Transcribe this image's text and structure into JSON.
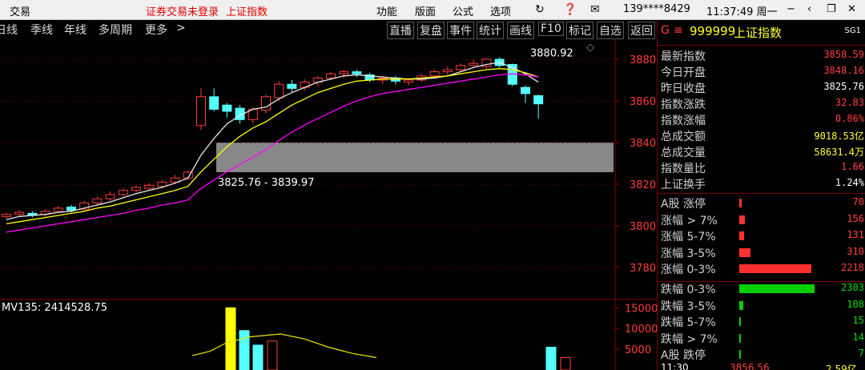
{
  "titlebar": {
    "menu_trade": "交易",
    "status_notice": "证券交易未登录",
    "index_name": "上证指数",
    "menu_function": "功能",
    "menu_layout": "版面",
    "menu_formula": "公式",
    "menu_options": "选项",
    "user": "139****8429",
    "clock": "11:37:49 周一"
  },
  "toolbar": {
    "period_items": [
      "日线",
      "季线",
      "年线",
      "多周期",
      "更多"
    ],
    "more_arrow": ">",
    "action_items": [
      "直播",
      "复盘",
      "事件",
      "统计",
      "画线",
      "F10",
      "标记",
      "自选",
      "返回"
    ]
  },
  "panel": {
    "header": {
      "prefix": "G",
      "code": "999999",
      "name": "上证指数",
      "tag": "SG1"
    },
    "stats": [
      {
        "label": "最新指数",
        "value": "3858.59",
        "color": "#ff4040"
      },
      {
        "label": "今日开盘",
        "value": "3848.16",
        "color": "#ff4040"
      },
      {
        "label": "昨日收盘",
        "value": "3825.76",
        "color": "#ffffff"
      },
      {
        "label": "指数涨跌",
        "value": "32.83",
        "color": "#ff4040"
      },
      {
        "label": "指数涨幅",
        "value": "0.86%",
        "color": "#ff4040"
      },
      {
        "label": "总成交额",
        "value": "9018.53亿",
        "color": "#ffff33"
      },
      {
        "label": "总成交量",
        "value": "58631.4万",
        "color": "#ffff33"
      },
      {
        "label": "指数量比",
        "value": "1.66",
        "color": "#ff4040"
      },
      {
        "label": "上证换手",
        "value": "1.24%",
        "color": "#ffffff"
      }
    ],
    "breadth": [
      {
        "label": "A股 涨停",
        "value": "70",
        "frac": 0.013,
        "color": "#ff3030"
      },
      {
        "label": "涨幅 > 7%",
        "value": "156",
        "frac": 0.03,
        "color": "#ff3030"
      },
      {
        "label": "涨幅 5-7%",
        "value": "131",
        "frac": 0.025,
        "color": "#ff3030"
      },
      {
        "label": "涨幅 3-5%",
        "value": "310",
        "frac": 0.06,
        "color": "#ff3030"
      },
      {
        "label": "涨幅 0-3%",
        "value": "2218",
        "frac": 0.39,
        "color": "#ff3030"
      },
      {
        "label": "跌幅 0-3%",
        "value": "2303",
        "frac": 0.41,
        "color": "#00d000"
      },
      {
        "label": "跌幅 3-5%",
        "value": "108",
        "frac": 0.02,
        "color": "#00d000"
      },
      {
        "label": "跌幅 5-7%",
        "value": "15",
        "frac": 0.006,
        "color": "#00d000"
      },
      {
        "label": "跌幅 > 7%",
        "value": "14",
        "frac": 0.006,
        "color": "#00d000"
      },
      {
        "label": "A股 跌停",
        "value": "7",
        "frac": 0.004,
        "color": "#00d000"
      }
    ],
    "footer_time": "11:30",
    "footer_value": "3856.56",
    "footer_extra": "2.59亿"
  },
  "chart_data": {
    "type": "candlestick",
    "y_ticks": [
      "3880",
      "3860",
      "3840",
      "3820",
      "3800",
      "3780"
    ],
    "ylim": [
      3770,
      3890
    ],
    "high_label": "3880.92",
    "gap_label": "3825.76 - 3839.97",
    "gap_range": [
      3825.76,
      3839.97
    ],
    "volume_label": "MV135: 2414528.75",
    "volume_ticks": [
      "15000",
      "10000",
      "5000"
    ],
    "volume_ylim": [
      0,
      17000
    ],
    "candles": [
      {
        "o": 3804.5,
        "c": 3805.5,
        "h": 3806.5,
        "l": 3803.5
      },
      {
        "o": 3805.5,
        "c": 3806.5,
        "h": 3807.5,
        "l": 3804.5
      },
      {
        "o": 3806.0,
        "c": 3805.0,
        "h": 3807.0,
        "l": 3804.0
      },
      {
        "o": 3805.5,
        "c": 3807.0,
        "h": 3808.0,
        "l": 3804.5
      },
      {
        "o": 3807.0,
        "c": 3808.5,
        "h": 3809.5,
        "l": 3806.0
      },
      {
        "o": 3809.0,
        "c": 3807.5,
        "h": 3810.0,
        "l": 3806.5
      },
      {
        "o": 3808.0,
        "c": 3811.0,
        "h": 3812.0,
        "l": 3807.0
      },
      {
        "o": 3811.0,
        "c": 3813.0,
        "h": 3814.0,
        "l": 3810.0
      },
      {
        "o": 3813.0,
        "c": 3815.0,
        "h": 3816.5,
        "l": 3812.0
      },
      {
        "o": 3815.0,
        "c": 3817.0,
        "h": 3818.0,
        "l": 3814.0
      },
      {
        "o": 3817.0,
        "c": 3818.5,
        "h": 3819.5,
        "l": 3816.0
      },
      {
        "o": 3818.0,
        "c": 3819.5,
        "h": 3820.5,
        "l": 3817.0
      },
      {
        "o": 3819.0,
        "c": 3821.0,
        "h": 3822.0,
        "l": 3818.0
      },
      {
        "o": 3821.0,
        "c": 3823.0,
        "h": 3824.5,
        "l": 3820.0
      },
      {
        "o": 3823.0,
        "c": 3825.76,
        "h": 3826.5,
        "l": 3822.0
      },
      {
        "o": 3848.16,
        "c": 3862.0,
        "h": 3866.0,
        "l": 3846.0
      },
      {
        "o": 3862.0,
        "c": 3856.0,
        "h": 3866.0,
        "l": 3855.0
      },
      {
        "o": 3858.0,
        "c": 3855.0,
        "h": 3859.0,
        "l": 3852.0
      },
      {
        "o": 3856.5,
        "c": 3851.0,
        "h": 3858.0,
        "l": 3849.0
      },
      {
        "o": 3851.0,
        "c": 3856.0,
        "h": 3857.0,
        "l": 3849.0
      },
      {
        "o": 3855.5,
        "c": 3862.0,
        "h": 3863.0,
        "l": 3854.0
      },
      {
        "o": 3861.5,
        "c": 3868.0,
        "h": 3869.5,
        "l": 3860.0
      },
      {
        "o": 3868.0,
        "c": 3866.0,
        "h": 3870.0,
        "l": 3864.0
      },
      {
        "o": 3866.5,
        "c": 3869.0,
        "h": 3870.5,
        "l": 3865.0
      },
      {
        "o": 3869.0,
        "c": 3871.0,
        "h": 3872.0,
        "l": 3867.0
      },
      {
        "o": 3871.0,
        "c": 3873.0,
        "h": 3874.0,
        "l": 3870.0
      },
      {
        "o": 3873.0,
        "c": 3874.0,
        "h": 3875.0,
        "l": 3871.0
      },
      {
        "o": 3874.0,
        "c": 3873.0,
        "h": 3875.0,
        "l": 3871.5
      },
      {
        "o": 3872.5,
        "c": 3870.0,
        "h": 3873.5,
        "l": 3869.0
      },
      {
        "o": 3870.0,
        "c": 3871.0,
        "h": 3872.0,
        "l": 3868.0
      },
      {
        "o": 3871.0,
        "c": 3869.5,
        "h": 3872.0,
        "l": 3868.0
      },
      {
        "o": 3869.0,
        "c": 3870.0,
        "h": 3871.0,
        "l": 3867.5
      },
      {
        "o": 3870.0,
        "c": 3872.0,
        "h": 3873.0,
        "l": 3869.0
      },
      {
        "o": 3872.0,
        "c": 3874.0,
        "h": 3875.0,
        "l": 3871.0
      },
      {
        "o": 3874.0,
        "c": 3875.0,
        "h": 3876.5,
        "l": 3872.5
      },
      {
        "o": 3875.0,
        "c": 3877.0,
        "h": 3878.0,
        "l": 3874.0
      },
      {
        "o": 3877.0,
        "c": 3878.0,
        "h": 3880.0,
        "l": 3876.0
      },
      {
        "o": 3876.5,
        "c": 3880.0,
        "h": 3880.5,
        "l": 3875.5
      },
      {
        "o": 3880.0,
        "c": 3877.0,
        "h": 3880.92,
        "l": 3876.0
      },
      {
        "o": 3877.5,
        "c": 3868.0,
        "h": 3878.0,
        "l": 3867.0
      },
      {
        "o": 3866.5,
        "c": 3863.5,
        "h": 3867.5,
        "l": 3859.0
      },
      {
        "o": 3862.5,
        "c": 3858.59,
        "h": 3863.0,
        "l": 3851.5
      }
    ],
    "series": [
      {
        "name": "MA5",
        "color": "#e8e8e8",
        "values": [
          3803.0,
          3804.5,
          3805.0,
          3805.5,
          3806.5,
          3807.0,
          3808.5,
          3810.0,
          3811.5,
          3813.5,
          3815.5,
          3817.0,
          3818.5,
          3820.5,
          3823.0,
          3834.0,
          3842.0,
          3849.0,
          3853.0,
          3856.0,
          3857.0,
          3861.0,
          3864.0,
          3866.5,
          3869.0,
          3870.5,
          3872.0,
          3872.5,
          3872.0,
          3871.5,
          3871.0,
          3870.5,
          3870.5,
          3871.0,
          3872.0,
          3874.0,
          3876.0,
          3877.5,
          3878.5,
          3876.0,
          3873.0,
          3869.0
        ]
      },
      {
        "name": "MA10",
        "color": "#ffff00",
        "values": [
          3801.0,
          3802.0,
          3803.0,
          3804.0,
          3805.0,
          3806.0,
          3807.0,
          3808.5,
          3809.5,
          3811.0,
          3812.5,
          3814.0,
          3815.5,
          3817.0,
          3819.0,
          3826.0,
          3832.0,
          3838.0,
          3843.0,
          3847.0,
          3850.0,
          3854.0,
          3858.0,
          3861.0,
          3864.0,
          3866.0,
          3868.0,
          3869.5,
          3870.0,
          3870.5,
          3870.5,
          3870.5,
          3871.0,
          3871.5,
          3872.0,
          3873.0,
          3874.0,
          3875.0,
          3875.5,
          3875.0,
          3873.5,
          3871.5
        ]
      },
      {
        "name": "MA20",
        "color": "#ff00ff",
        "values": [
          3797.0,
          3798.0,
          3799.0,
          3800.0,
          3801.0,
          3802.0,
          3803.0,
          3804.0,
          3805.0,
          3806.0,
          3807.5,
          3808.5,
          3810.0,
          3811.0,
          3812.5,
          3818.0,
          3822.0,
          3826.0,
          3829.5,
          3833.0,
          3836.5,
          3841.0,
          3845.0,
          3848.5,
          3851.5,
          3854.5,
          3857.5,
          3860.0,
          3862.0,
          3863.5,
          3864.5,
          3865.5,
          3866.5,
          3867.5,
          3868.5,
          3869.5,
          3870.5,
          3871.5,
          3872.5,
          3873.0,
          3872.5,
          3871.5
        ]
      }
    ],
    "volumes": [
      {
        "v": 0,
        "up": true
      },
      {
        "v": 15000,
        "up": true
      },
      {
        "v": 9500,
        "up": false
      },
      {
        "v": 6000,
        "up": false
      },
      {
        "v": 7000,
        "up": true
      },
      {
        "v": 5500,
        "up": false
      },
      {
        "v": 3000,
        "up": true
      }
    ],
    "volume_ma": [
      3500,
      4500,
      6500,
      8000,
      8700,
      7500,
      5500,
      4000,
      3000
    ]
  }
}
